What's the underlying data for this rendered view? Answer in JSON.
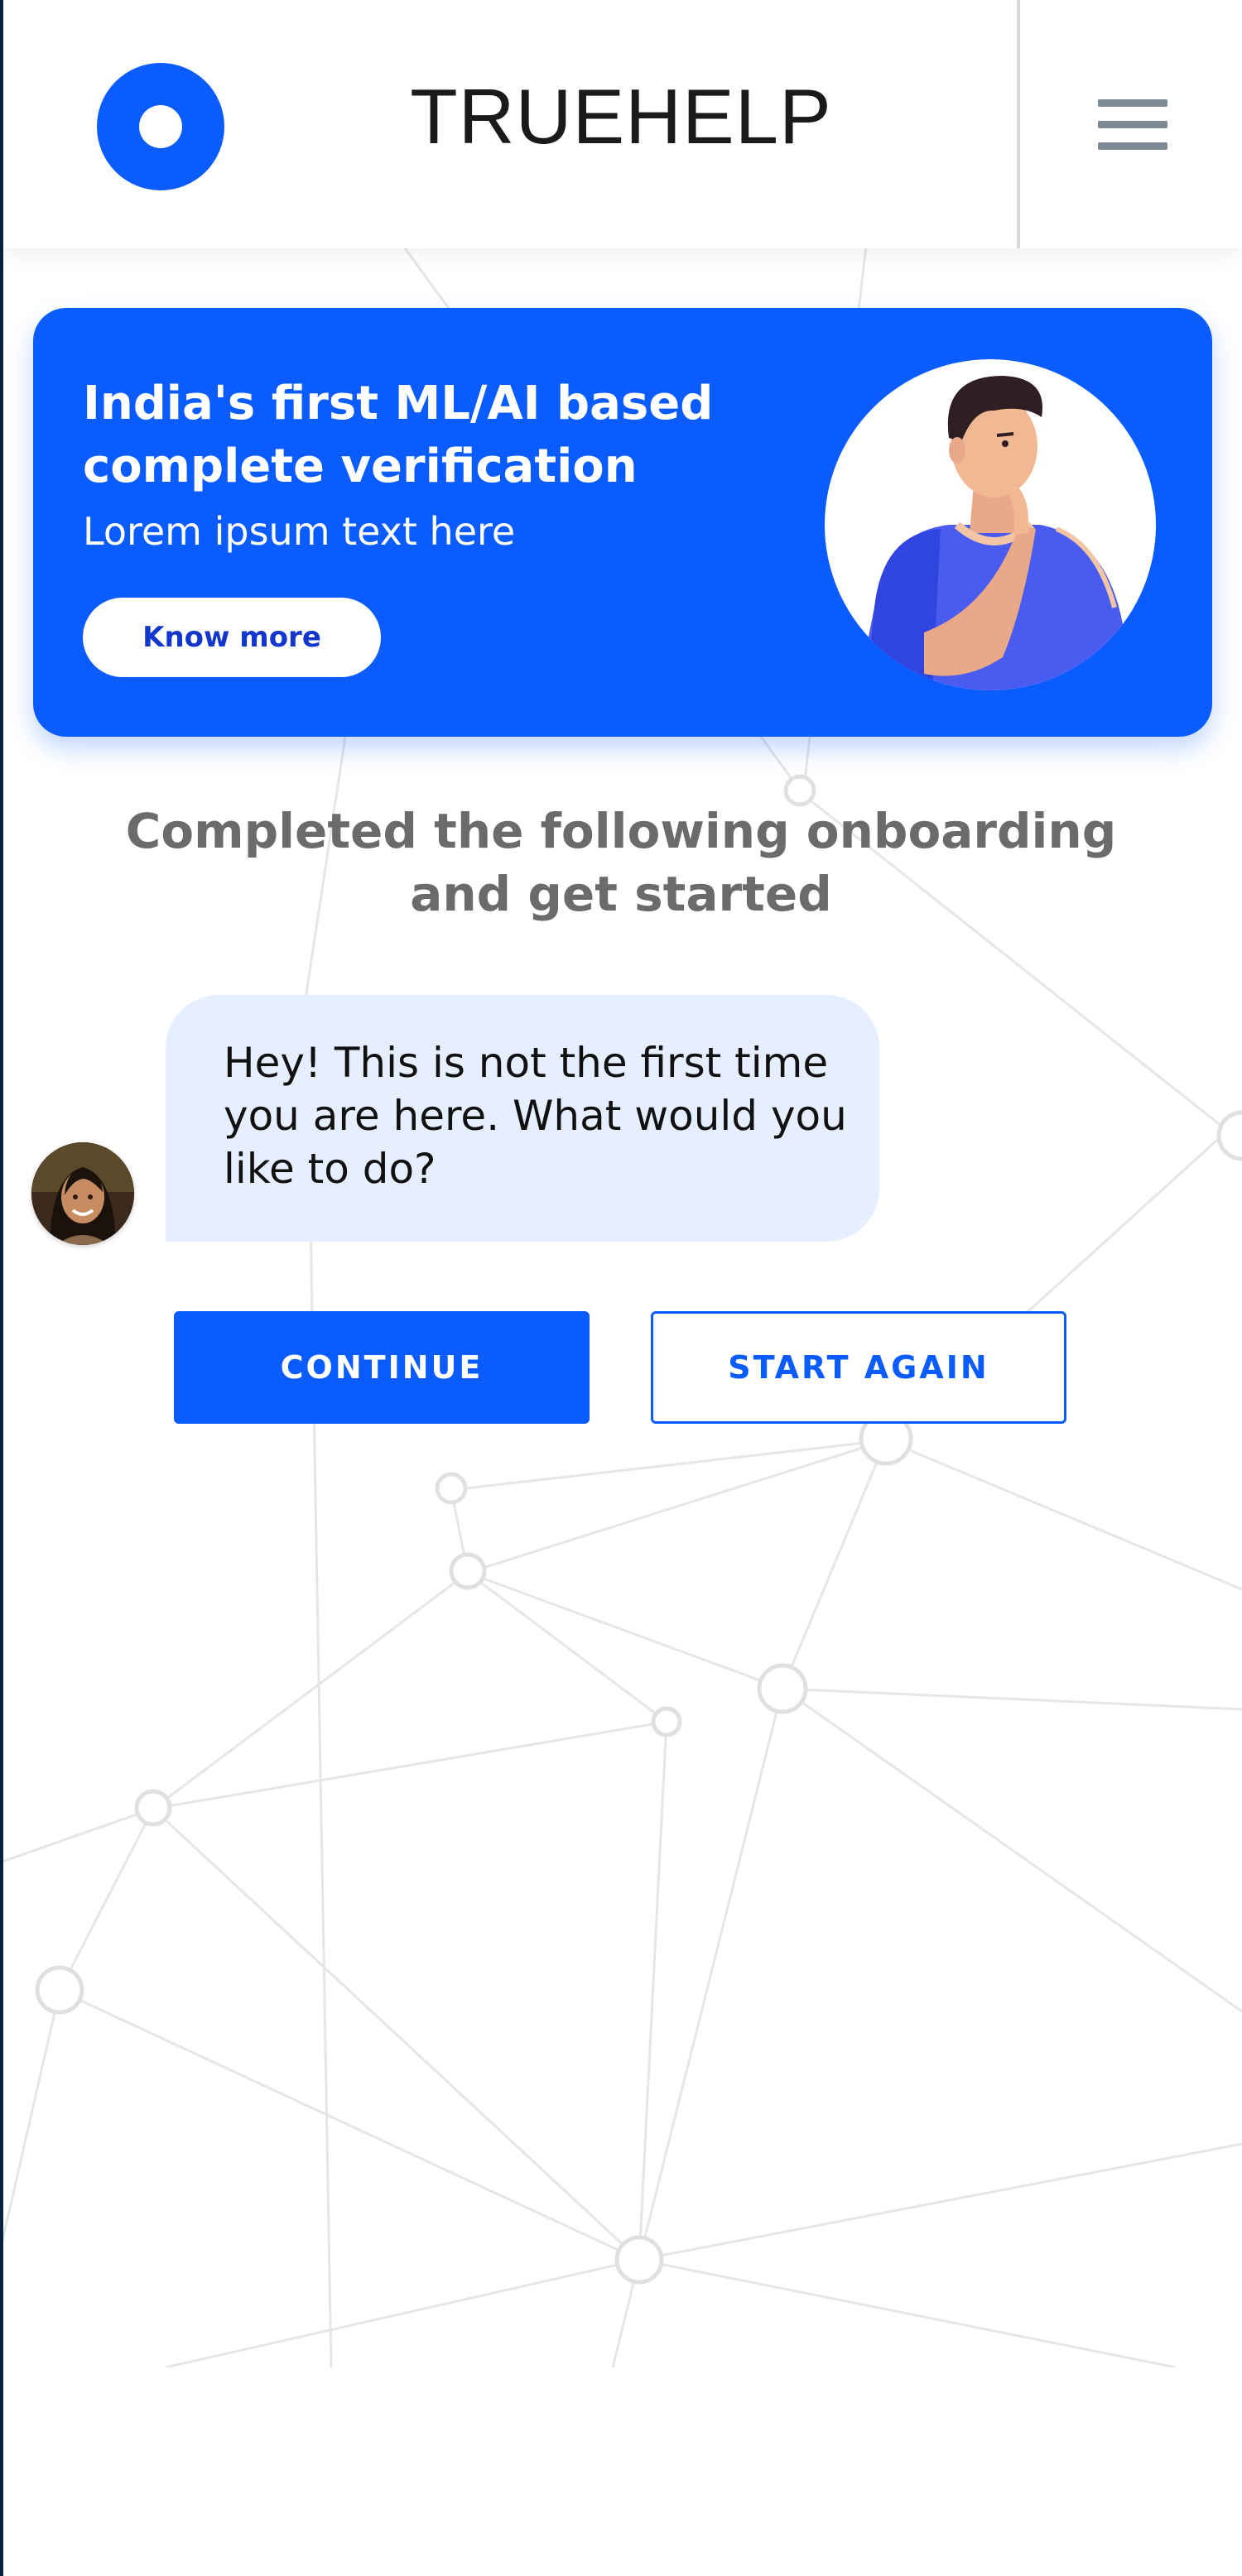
{
  "header": {
    "brand": "TRUEHELP",
    "logo_icon": "circle-logo-icon",
    "menu_icon": "hamburger-menu-icon"
  },
  "banner": {
    "title": "India's first ML/AI based complete verification",
    "subtitle": "Lorem ipsum text here",
    "cta_label": "Know more",
    "illustration": "thinking-man-illustration"
  },
  "onboarding": {
    "heading": "Completed the following onboarding and get started"
  },
  "chat": {
    "agent_avatar": "agent-avatar-photo",
    "message": "Hey! This is not the first time you are here. What would you like to do?"
  },
  "actions": {
    "continue_label": "CONTINUE",
    "start_again_label": "START AGAIN"
  },
  "colors": {
    "primary": "#0a5cff",
    "bubble": "#e6efff",
    "heading_text": "#6b6b6b",
    "menu_icon": "#7d8a96"
  }
}
